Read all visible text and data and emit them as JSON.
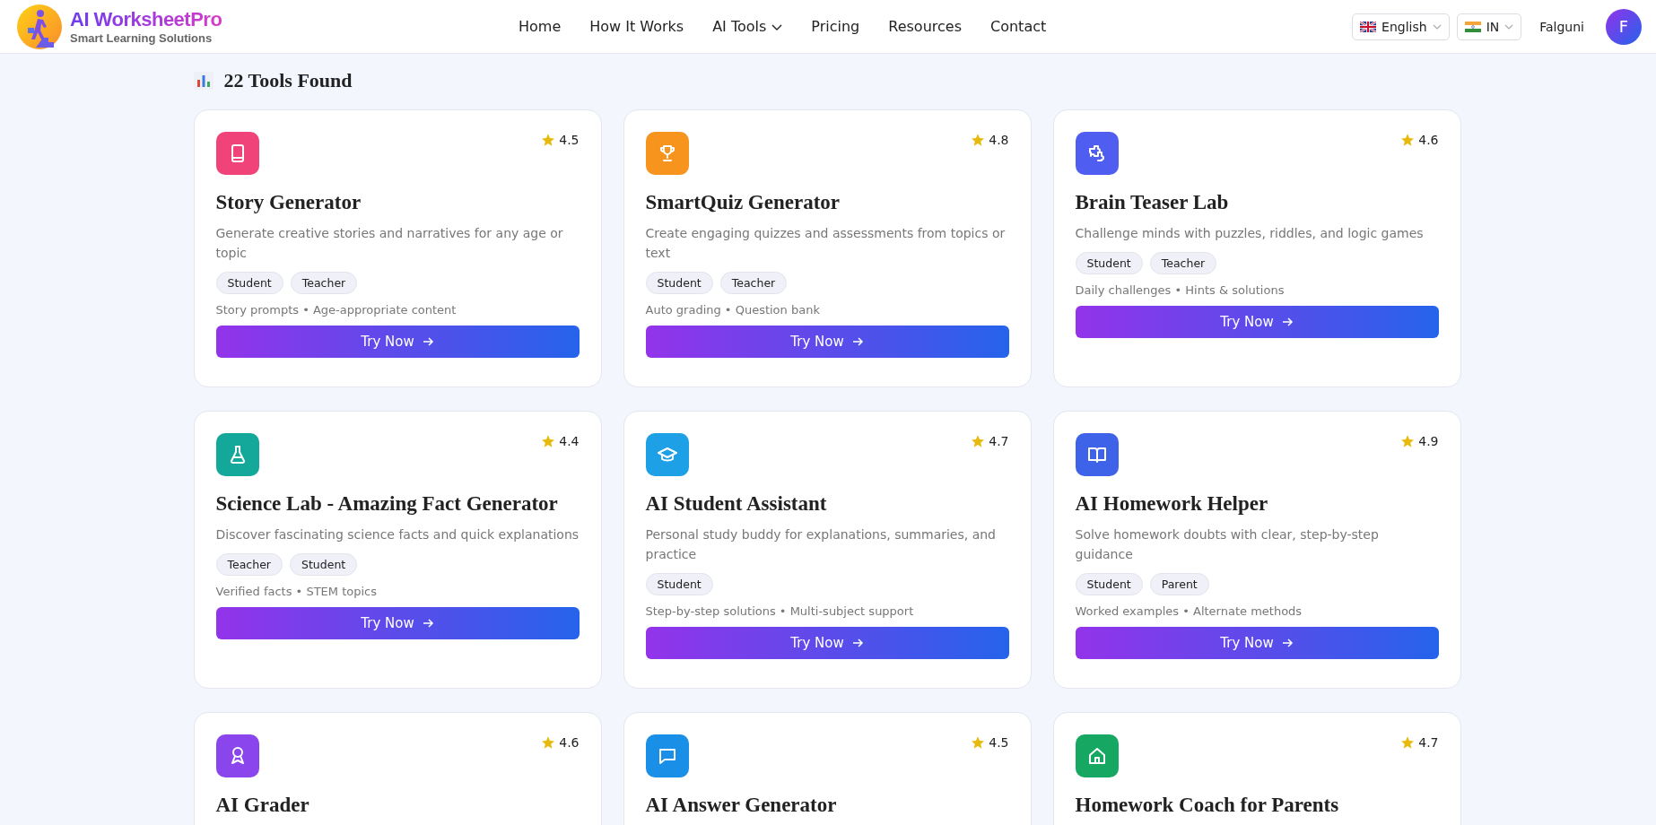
{
  "header": {
    "brand": "AI WorksheetPro",
    "tagline": "Smart Learning Solutions",
    "nav": [
      {
        "label": "Home",
        "dropdown": false
      },
      {
        "label": "How It Works",
        "dropdown": false
      },
      {
        "label": "AI Tools",
        "dropdown": true
      },
      {
        "label": "Pricing",
        "dropdown": false
      },
      {
        "label": "Resources",
        "dropdown": false
      },
      {
        "label": "Contact",
        "dropdown": false
      }
    ],
    "language": "English",
    "region": "IN",
    "user_name": "Falguni",
    "avatar_initial": "F"
  },
  "results_heading": "22 Tools Found",
  "tools": [
    {
      "name": "Story Generator",
      "rating": "4.5",
      "color": "#f0437a",
      "description": "Generate creative stories and narratives for any age or topic",
      "tags": [
        "Student",
        "Teacher"
      ],
      "features": "Story prompts • Age-appropriate content",
      "button": "Try Now"
    },
    {
      "name": "SmartQuiz Generator",
      "rating": "4.8",
      "color": "#f7941d",
      "description": "Create engaging quizzes and assessments from topics or text",
      "tags": [
        "Student",
        "Teacher"
      ],
      "features": "Auto grading • Question bank",
      "button": "Try Now"
    },
    {
      "name": "Brain Teaser Lab",
      "rating": "4.6",
      "color": "#4f5df0",
      "description": "Challenge minds with puzzles, riddles, and logic games",
      "tags": [
        "Student",
        "Teacher"
      ],
      "features": "Daily challenges • Hints & solutions",
      "button": "Try Now"
    },
    {
      "name": "Science Lab - Amazing Fact Generator",
      "rating": "4.4",
      "color": "#14a89a",
      "description": "Discover fascinating science facts and quick explanations",
      "tags": [
        "Teacher",
        "Student"
      ],
      "features": "Verified facts • STEM topics",
      "button": "Try Now"
    },
    {
      "name": "AI Student Assistant",
      "rating": "4.7",
      "color": "#1ea0e6",
      "description": "Personal study buddy for explanations, summaries, and practice",
      "tags": [
        "Student"
      ],
      "features": "Step-by-step solutions • Multi-subject support",
      "button": "Try Now"
    },
    {
      "name": "AI Homework Helper",
      "rating": "4.9",
      "color": "#3f63e8",
      "description": "Solve homework doubts with clear, step-by-step guidance",
      "tags": [
        "Student",
        "Parent"
      ],
      "features": "Worked examples • Alternate methods",
      "button": "Try Now"
    },
    {
      "name": "AI Grader",
      "rating": "4.6",
      "color": "#8b45ec"
    },
    {
      "name": "AI Answer Generator",
      "rating": "4.5",
      "color": "#1a8fe8"
    },
    {
      "name": "Homework Coach for Parents",
      "rating": "4.7",
      "color": "#16a862"
    }
  ]
}
